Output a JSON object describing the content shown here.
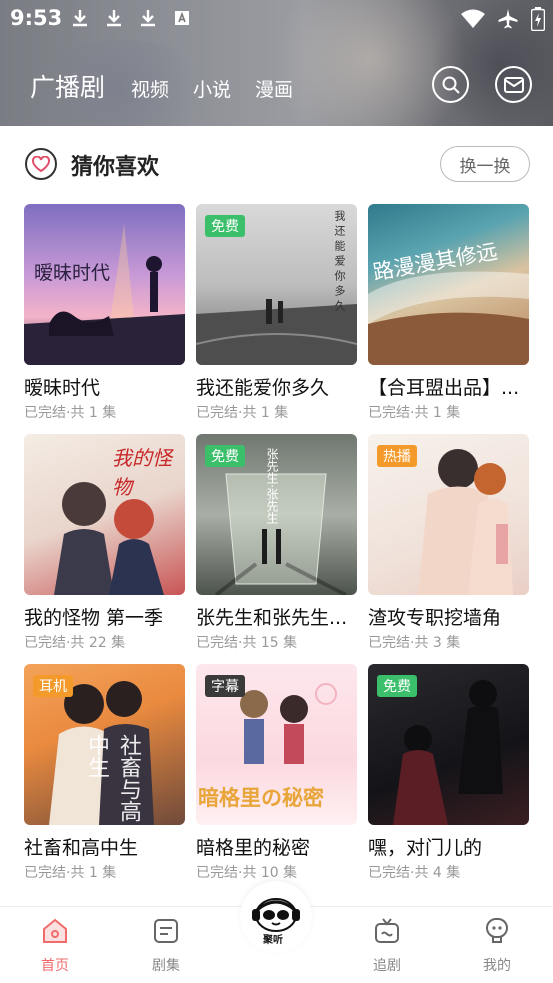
{
  "status_bar": {
    "time": "9:53",
    "left_icons": [
      "download-icon",
      "download-icon",
      "download-icon",
      "font-a-icon"
    ],
    "right_icons": [
      "wifi-icon",
      "airplane-icon",
      "battery-charging-icon"
    ]
  },
  "header": {
    "tabs": [
      {
        "label": "广播剧",
        "active": true
      },
      {
        "label": "视频",
        "active": false
      },
      {
        "label": "小说",
        "active": false
      },
      {
        "label": "漫画",
        "active": false
      }
    ],
    "search_icon": "search-icon",
    "mail_icon": "mail-icon"
  },
  "section": {
    "title": "猜你喜欢",
    "refresh_label": "换一换"
  },
  "items": [
    {
      "title": "暧昧时代",
      "meta": "已完结·共 1 集",
      "badge": "",
      "cover_text": "暧昧时代"
    },
    {
      "title": "我还能爱你多久",
      "meta": "已完结·共 1 集",
      "badge": "免费",
      "cover_text": "我还能爱你多久"
    },
    {
      "title": "【合耳盟出品】...",
      "meta": "已完结·共 1 集",
      "badge": "",
      "cover_text": "路漫漫其修远"
    },
    {
      "title": "我的怪物 第一季",
      "meta": "已完结·共 22 集",
      "badge": "",
      "cover_text": "我的怪物"
    },
    {
      "title": "张先生和张先生...",
      "meta": "已完结·共 15 集",
      "badge": "免费",
      "cover_text": "张先生·张先生"
    },
    {
      "title": "渣攻专职挖墙角",
      "meta": "已完结·共 3 集",
      "badge": "热播",
      "cover_text": ""
    },
    {
      "title": "社畜和高中生",
      "meta": "已完结·共 1 集",
      "badge": "耳机",
      "cover_text": "社畜与高中生"
    },
    {
      "title": "暗格里的秘密",
      "meta": "已完结·共 10 集",
      "badge": "字幕",
      "cover_text": "暗格里の秘密"
    },
    {
      "title": "嘿，对门儿的",
      "meta": "已完结·共 4 集",
      "badge": "免费",
      "cover_text": ""
    }
  ],
  "colors": {
    "badge_green": "#3bbf6a",
    "badge_orange": "#f39a2b",
    "badge_dark": "#3a3a3a",
    "active_tab": "#f06b6b"
  },
  "tabbar": {
    "items": [
      {
        "label": "首页",
        "icon": "home-icon",
        "active": true
      },
      {
        "label": "剧集",
        "icon": "list-icon",
        "active": false
      },
      {
        "label": "",
        "icon": "mascot-icon",
        "active": false
      },
      {
        "label": "追剧",
        "icon": "tv-icon",
        "active": false
      },
      {
        "label": "我的",
        "icon": "profile-icon",
        "active": false
      }
    ],
    "center_label": "聚听"
  }
}
